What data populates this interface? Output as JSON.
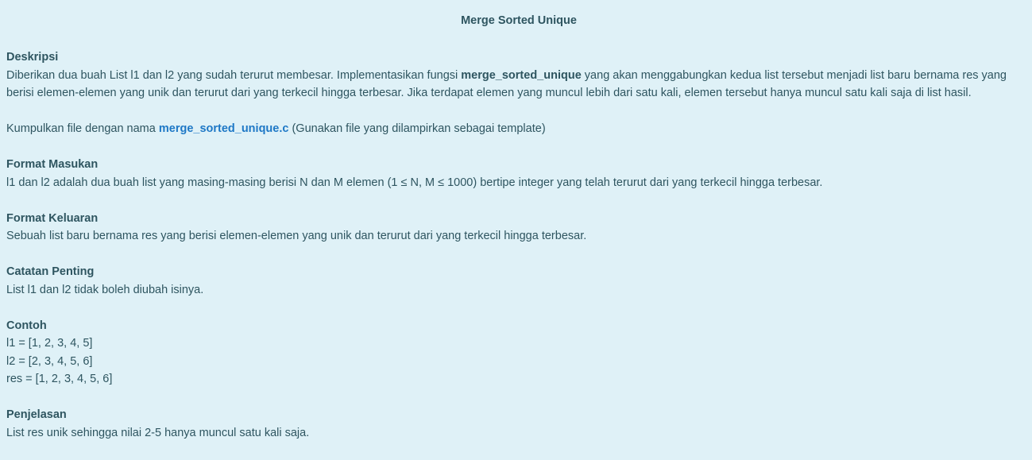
{
  "title": "Merge Sorted Unique",
  "deskripsi": {
    "heading": "Deskripsi",
    "line1_pre": "Diberikan dua buah List l1 dan l2 yang sudah terurut membesar. Implementasikan fungsi ",
    "line1_func": "merge_sorted_unique",
    "line1_post": " yang akan menggabungkan kedua list tersebut menjadi list baru bernama res yang",
    "line2": "berisi elemen-elemen yang unik dan terurut dari yang terkecil hingga terbesar. Jika terdapat elemen yang muncul lebih dari satu kali, elemen tersebut hanya muncul satu kali saja di list hasil."
  },
  "kumpulkan": {
    "pre": "Kumpulkan file dengan nama ",
    "file": "merge_sorted_unique.c",
    "post": " (Gunakan file yang dilampirkan sebagai template)"
  },
  "format_masukan": {
    "heading": "Format Masukan",
    "text": "l1 dan l2 adalah dua buah list yang masing-masing berisi N dan M elemen (1 ≤ N, M ≤ 1000) bertipe integer yang telah terurut dari yang terkecil hingga terbesar."
  },
  "format_keluaran": {
    "heading": "Format Keluaran",
    "text": "Sebuah list baru bernama res yang berisi elemen-elemen yang unik dan terurut dari yang terkecil hingga terbesar."
  },
  "catatan": {
    "heading": "Catatan Penting",
    "text": "List l1 dan l2 tidak boleh diubah isinya."
  },
  "contoh": {
    "heading": "Contoh",
    "lines": [
      "l1 = [1, 2, 3, 4, 5]",
      "l2 = [2, 3, 4, 5, 6]",
      "res = [1, 2, 3, 4, 5, 6]"
    ]
  },
  "penjelasan": {
    "heading": "Penjelasan",
    "text": "List res unik sehingga nilai 2-5 hanya muncul satu kali saja."
  }
}
